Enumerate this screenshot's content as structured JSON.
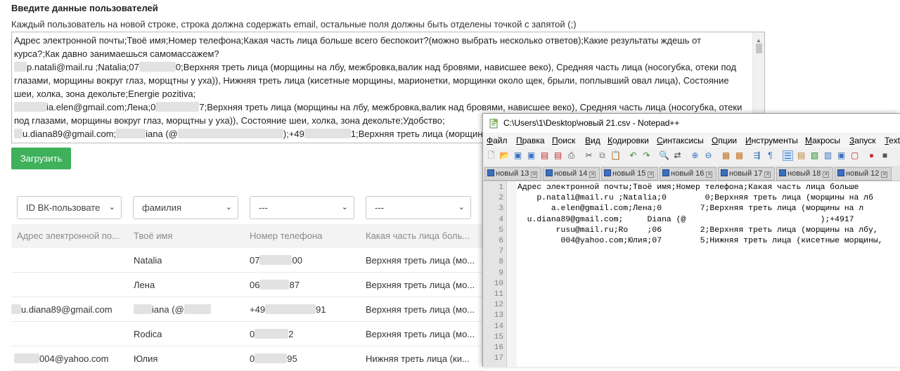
{
  "page": {
    "title": "Введите данные пользователей",
    "hint": "Каждый пользователь на новой строке, строка должна содержать email, остальные поля должны быть отделены точкой с запятой (;)",
    "textarea_lines": [
      "Адрес электронной почты;Твоё имя;Номер телефона;Какая часть лица больше всего беспокоит?(можно выбрать несколько ответов);Какие результаты ждешь от курса?;Как давно занимаешься самомассажем?",
      "p.natali@mail.ru ;Natalia;07",
      "0;Верхняя треть лица (морщины на лбу, межбровка,валик над бровями, нависшее веко), Средняя часть лица (носогубка, отеки под глазами, морщины вокруг глаз, морщтны у уха)), Нижняя треть лица (кисетные морщины,  марионетки, морщинки около щек, брыли, поплывший овал лица), Состояние шеи, холка, зона декольте;Energie pozitiva;",
      "ia.elen@gmail.com;Лена;0",
      "7;Верхняя треть лица (морщины на лбу, межбровка,валик над бровями, нависшее веко), Средняя часть лица (носогубка, отеки под глазами, морщины вокруг глаз, морщтны у уха)), Состояние шеи, холка, зона декольте;Удобство;",
      "u.diana89@gmail.com;",
      "iana (@",
      ");+49",
      "1;Верхняя треть лица (морщины"
    ],
    "upload_button": "Загрузить",
    "selects": [
      "ID ВК-пользовате",
      "фамилия",
      "---",
      "---"
    ],
    "table": {
      "headers": [
        "Адрес электронной по...",
        "Твоё имя",
        "Номер телефона",
        "Какая часть лица боль..."
      ],
      "rows": [
        [
          "",
          "Natalia",
          "07",
          "00",
          "Верхняя треть лица (мо..."
        ],
        [
          "",
          "Лена",
          "06",
          "87",
          "Верхняя треть лица (мо..."
        ],
        [
          "u.diana89@gmail.com",
          "iana (@",
          "+49",
          "91",
          "Верхняя треть лица (мо..."
        ],
        [
          "",
          "Rodica",
          "0",
          "2",
          "Верхняя треть лица (мо..."
        ],
        [
          "004@yahoo.com",
          "Юлия",
          "0",
          "95",
          "Нижняя треть лица (ки..."
        ]
      ]
    }
  },
  "notepad": {
    "title": "C:\\Users\\1\\Desktop\\новый 21.csv - Notepad++",
    "menu": [
      "Файл",
      "Правка",
      "Поиск",
      "Вид",
      "Кодировки",
      "Синтаксисы",
      "Опции",
      "Инструменты",
      "Макросы",
      "Запуск",
      "TextFX"
    ],
    "tabs": [
      "новый 13",
      "новый 14",
      "новый 15",
      "новый 16",
      "новый 17",
      "новый 18",
      "новый 12"
    ],
    "line_numbers": [
      "1",
      "2",
      "3",
      "4",
      "5",
      "6",
      "7",
      "8",
      "9",
      "10",
      "11",
      "12",
      "13",
      "14",
      "15",
      "16",
      "17"
    ],
    "code_lines": [
      "Адрес электронной почты;Твоё имя;Номер телефона;Какая часть лица больше",
      "    p.natali@mail.ru ;Natalia;0        0;Верхняя треть лица (морщины на лб",
      "       a.elen@gmail.com;Лена;0        7;Верхняя треть лица (морщины на л",
      "  u.diana89@gmail.com;     Diana (@                            );+4917",
      "        rusu@mail.ru;Ro    ;06        2;Верхняя треть лица (морщины на лбу,",
      "         004@yahoo.com;Юлия;07        5;Нижняя треть лица (кисетные морщины,"
    ]
  },
  "colors": {
    "upload_green": "#3eb15a",
    "table_header_bg": "#f3f3f3"
  }
}
